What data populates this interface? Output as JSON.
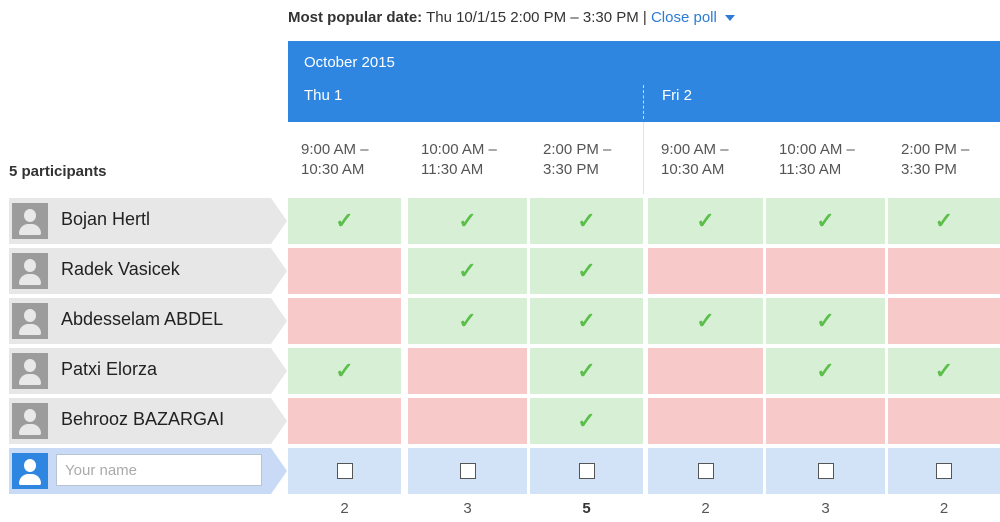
{
  "poll": {
    "most_popular_label": "Most popular date:",
    "most_popular_value": "Thu 10/1/15 2:00 PM – 3:30 PM |",
    "close_poll_label": "Close poll"
  },
  "calendar": {
    "month": "October 2015",
    "days": [
      "Thu 1",
      "Fri 2"
    ],
    "slots": [
      {
        "start": "9:00 AM –",
        "end": "10:30 AM"
      },
      {
        "start": "10:00 AM –",
        "end": "11:30 AM"
      },
      {
        "start": "2:00 PM –",
        "end": "3:30 PM"
      },
      {
        "start": "9:00 AM –",
        "end": "10:30 AM"
      },
      {
        "start": "10:00 AM –",
        "end": "11:30 AM"
      },
      {
        "start": "2:00 PM –",
        "end": "3:30 PM"
      }
    ]
  },
  "participants_label": "5 participants",
  "participants": [
    {
      "name": "Bojan Hertl",
      "votes": [
        true,
        true,
        true,
        true,
        true,
        true
      ]
    },
    {
      "name": "Radek Vasicek",
      "votes": [
        false,
        true,
        true,
        false,
        false,
        false
      ]
    },
    {
      "name": "Abdesselam ABDEL",
      "votes": [
        false,
        true,
        true,
        true,
        true,
        false
      ]
    },
    {
      "name": "Patxi Elorza",
      "votes": [
        true,
        false,
        true,
        false,
        true,
        true
      ]
    },
    {
      "name": "Behrooz BAZARGAI",
      "votes": [
        false,
        false,
        true,
        false,
        false,
        false
      ]
    }
  ],
  "new_participant": {
    "placeholder": "Your name"
  },
  "totals": [
    "2",
    "3",
    "5",
    "2",
    "3",
    "2"
  ],
  "icons": {
    "check": "checkmark-icon",
    "avatar": "user-avatar-icon",
    "caret": "caret-down-icon"
  },
  "colors": {
    "yes": "#d7f0d5",
    "no": "#f8c9c9",
    "header": "#2e86e0",
    "link": "#2b7bd8",
    "check": "#5cbf4b"
  }
}
